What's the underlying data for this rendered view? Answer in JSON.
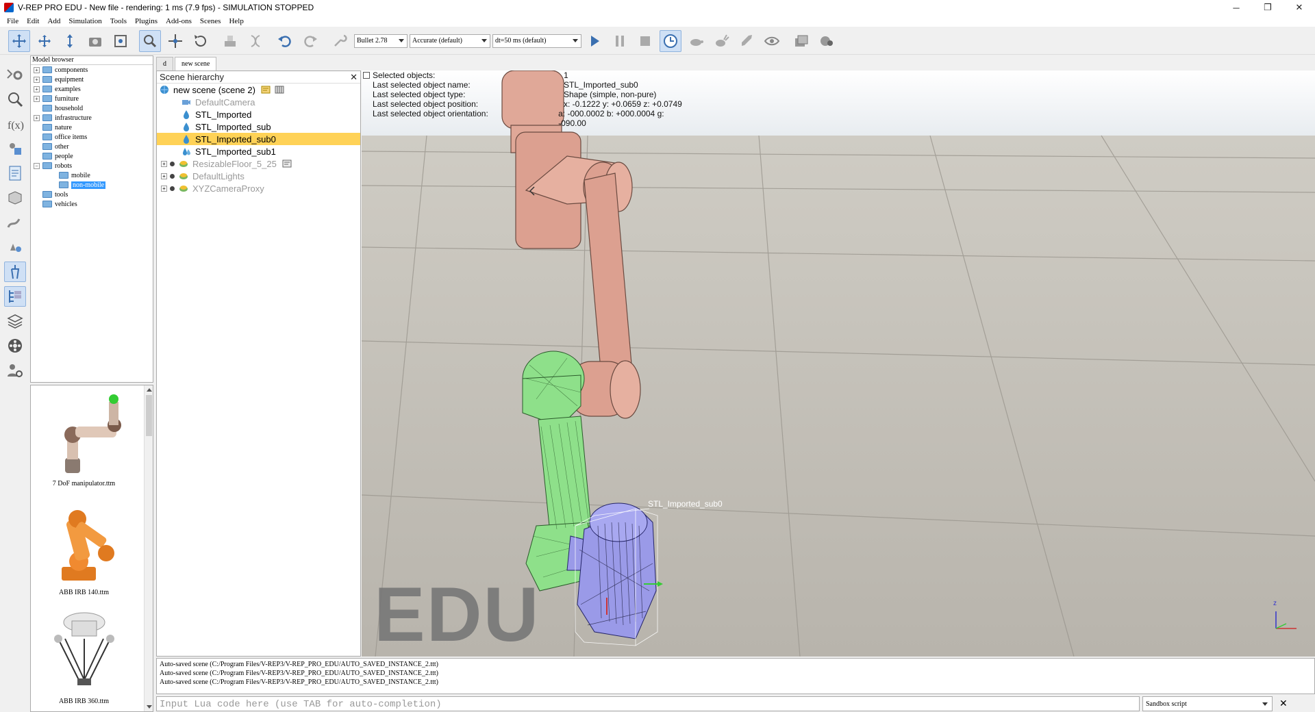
{
  "window": {
    "title": "V-REP PRO EDU - New file - rendering: 1 ms (7.9 fps) - SIMULATION STOPPED",
    "minimize": "─",
    "maximize": "❐",
    "close": "✕"
  },
  "menu": [
    "File",
    "Edit",
    "Add",
    "Simulation",
    "Tools",
    "Plugins",
    "Add-ons",
    "Scenes",
    "Help"
  ],
  "toolbar": {
    "engine": "Bullet 2.78",
    "accuracy": "Accurate (default)",
    "timestep": "dt=50 ms (default)"
  },
  "model_browser": {
    "header": "Model browser",
    "items": [
      {
        "label": "components",
        "expandable": true
      },
      {
        "label": "equipment",
        "expandable": true
      },
      {
        "label": "examples",
        "expandable": true
      },
      {
        "label": "furniture",
        "expandable": true
      },
      {
        "label": "household",
        "expandable": false
      },
      {
        "label": "infrastructure",
        "expandable": true
      },
      {
        "label": "nature",
        "expandable": false
      },
      {
        "label": "office items",
        "expandable": false
      },
      {
        "label": "other",
        "expandable": false
      },
      {
        "label": "people",
        "expandable": false
      },
      {
        "label": "robots",
        "expandable": true
      },
      {
        "label": "mobile",
        "expandable": false
      },
      {
        "label": "non-mobile",
        "expandable": false
      },
      {
        "label": "tools",
        "expandable": false
      },
      {
        "label": "vehicles",
        "expandable": false
      }
    ]
  },
  "thumbnails": [
    {
      "label": "7 DoF manipulator.ttm"
    },
    {
      "label": "ABB IRB 140.ttm"
    },
    {
      "label": "ABB IRB 360.ttm"
    }
  ],
  "tabs": [
    "d",
    "new scene"
  ],
  "hierarchy": {
    "title": "Scene hierarchy",
    "close": "✕",
    "root": "new scene (scene 2)",
    "items": [
      {
        "label": "DefaultCamera"
      },
      {
        "label": "STL_Imported"
      },
      {
        "label": "STL_Imported_sub"
      },
      {
        "label": "STL_Imported_sub0"
      },
      {
        "label": "STL_Imported_sub1"
      },
      {
        "label": "ResizableFloor_5_25"
      },
      {
        "label": "DefaultLights"
      },
      {
        "label": "XYZCameraProxy"
      }
    ]
  },
  "info": {
    "rows": [
      {
        "k": "Selected objects:",
        "v": "1"
      },
      {
        "k": "Last selected object name:",
        "v": "STL_Imported_sub0"
      },
      {
        "k": "Last selected object type:",
        "v": "Shape (simple, non-pure)"
      },
      {
        "k": "Last selected object position:",
        "v": "x: -0.1222   y: +0.0659   z: +0.0749"
      },
      {
        "k": "Last selected object orientation:",
        "v": "a: -000.0002   b: +000.0004   g: -090.00"
      }
    ]
  },
  "viewport": {
    "watermark": "EDU",
    "object_label": "STL_Imported_sub0",
    "axis_z": "z"
  },
  "console": [
    "Auto-saved scene (C:/Program Files/V-REP3/V-REP_PRO_EDU/AUTO_SAVED_INSTANCE_2.ttt)",
    "Auto-saved scene (C:/Program Files/V-REP3/V-REP_PRO_EDU/AUTO_SAVED_INSTANCE_2.ttt)",
    "Auto-saved scene (C:/Program Files/V-REP3/V-REP_PRO_EDU/AUTO_SAVED_INSTANCE_2.ttt)"
  ],
  "lua": {
    "placeholder": "Input Lua code here (use TAB for auto-completion)",
    "script": "Sandbox script",
    "close": "✕"
  },
  "colors": {
    "selection": "#ffd257",
    "arm": "#e0a898",
    "green_part": "#8ee08a",
    "blue_part": "#9a9ae8"
  }
}
